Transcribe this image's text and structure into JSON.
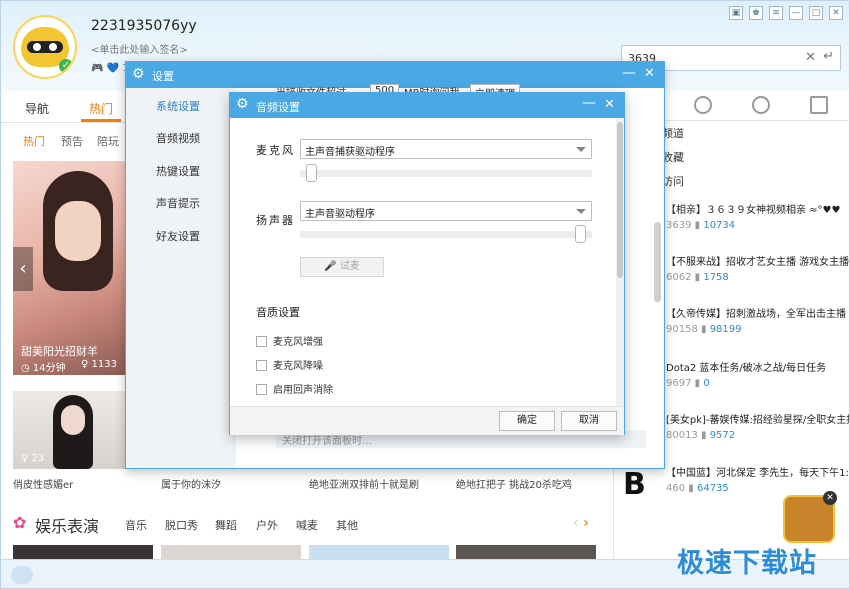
{
  "profile": {
    "username": "2231935076yy",
    "signature": "<单击此处输入签名>",
    "status_icons": "🎮 💙 1"
  },
  "search": {
    "value": "3639"
  },
  "nav": {
    "tabs": [
      "导航",
      "热门"
    ],
    "subtabs": [
      "热门",
      "预告",
      "陪玩"
    ]
  },
  "cards": [
    {
      "caption": "甜美阳光招财羊",
      "duration": "◷ 14分钟",
      "viewers": "♀ 1133"
    },
    {
      "viewers": "♀ 23"
    }
  ],
  "row_captions": [
    "俏皮性感媚er",
    "属于你的沫汐",
    "绝地亚洲双排前十就是刷",
    "绝地扛把子 挑战20杀吃鸡"
  ],
  "entertainment": {
    "title": "娱乐表演",
    "categories": [
      "音乐",
      "脱口秀",
      "舞蹈",
      "户外",
      "喊麦",
      "其他"
    ]
  },
  "right_panel": {
    "menu": [
      "频道",
      "收藏",
      "访问"
    ],
    "items": [
      {
        "title": "【相亲】３６３９女神视频相亲 ≈°♥♥",
        "id": "3639",
        "count": "10734"
      },
      {
        "title": "【不服来战】招收才艺女主播 游戏女主播",
        "id": "6062",
        "count": "1758"
      },
      {
        "title": "【久帝传媒】招刺激战场，全军出击主播",
        "id": "90158",
        "count": "98199"
      },
      {
        "title": "Dota2 蓝本任务/破冰之战/每日任务",
        "id": "9697",
        "count": "0"
      },
      {
        "title": "[美女pk]-蕃娱传媒:招经验星探/全职女主播",
        "id": "80013",
        "count": "9572"
      },
      {
        "title": "【中国蓝】河北保定 李先生，每天下午1:",
        "id": "460",
        "count": "64735"
      }
    ]
  },
  "settings_dialog": {
    "title": "设置",
    "sidebar": [
      "系统设置",
      "音频视频",
      "热键设置",
      "声音提示",
      "好友设置"
    ],
    "behind_texts": [
      "当接收文件超过",
      "500",
      "MB时询问我",
      "立即清理"
    ],
    "faded_text": "关闭打开该面板时…"
  },
  "audio_dialog": {
    "title": "音频设置",
    "mic_label": "麦克风",
    "mic_device": "主声音捕获驱动程序",
    "mic_level": 0.02,
    "speaker_label": "扬声器",
    "speaker_device": "主声音驱动程序",
    "speaker_level": 0.98,
    "test_button": "试麦",
    "quality_section": "音质设置",
    "checkboxes": [
      "麦克风增强",
      "麦克风降噪",
      "启用回声消除"
    ],
    "ok": "确定",
    "cancel": "取消"
  },
  "watermark": "极速下载站"
}
